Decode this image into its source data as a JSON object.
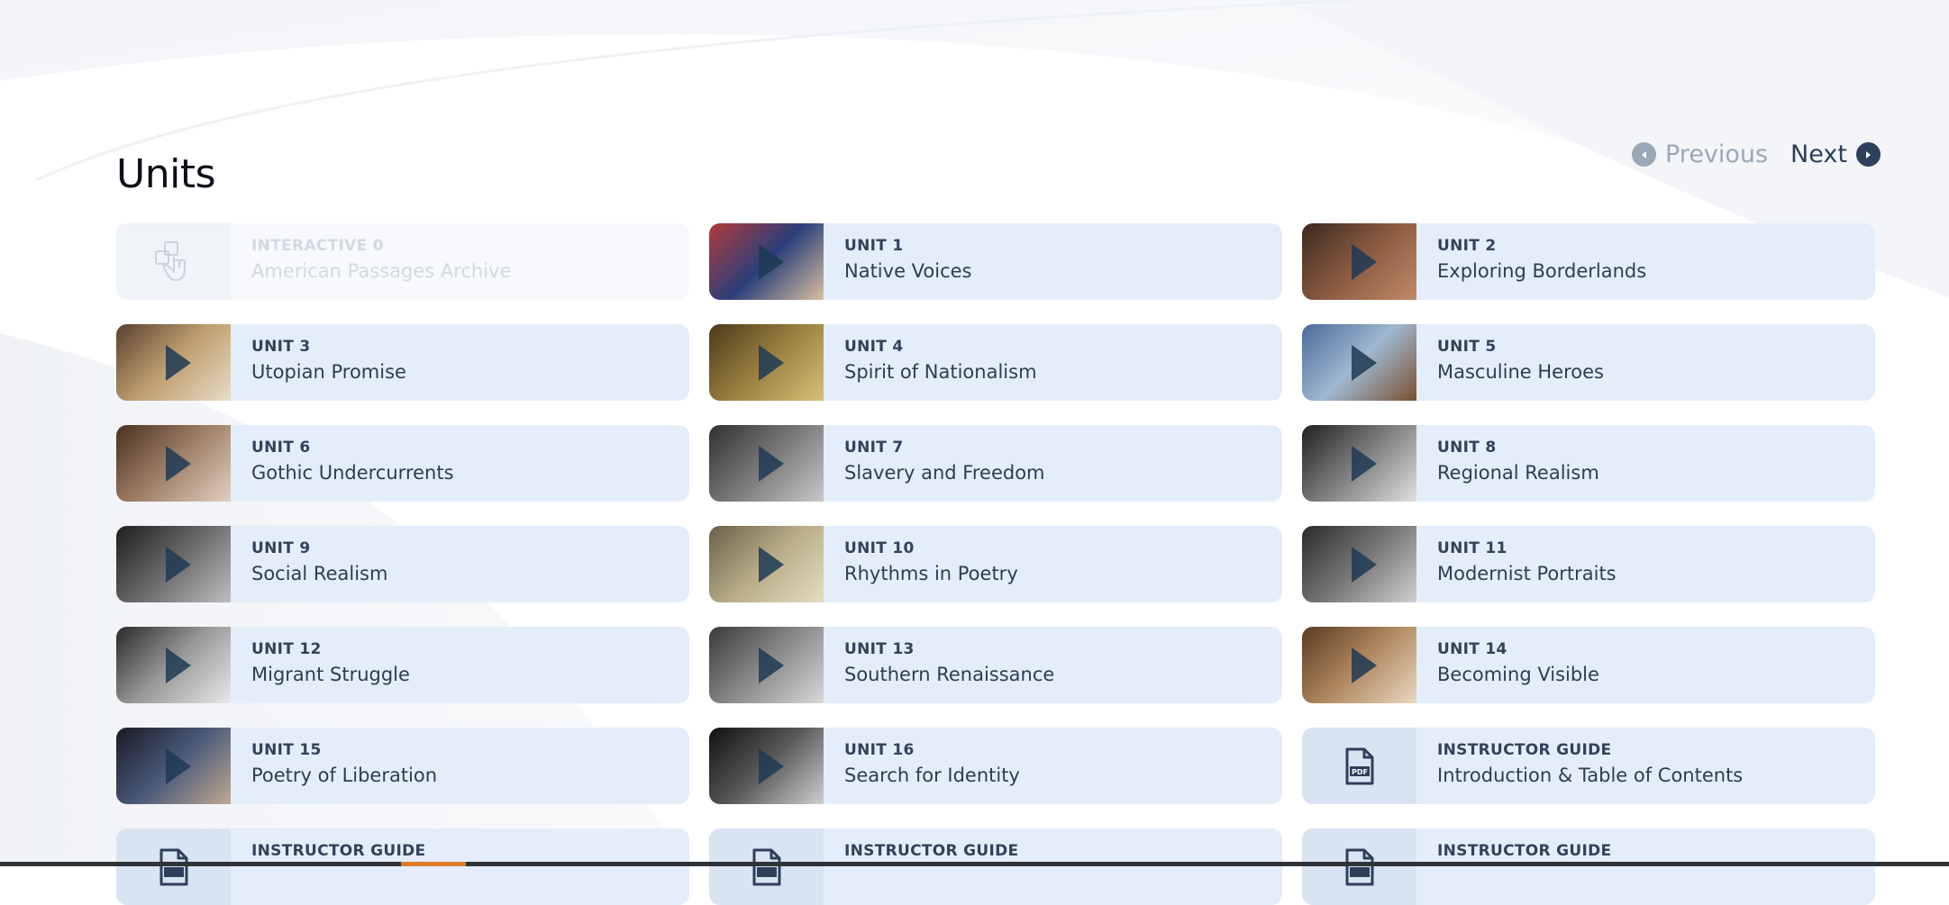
{
  "page": {
    "title": "Units"
  },
  "pager": {
    "previous_label": "Previous",
    "next_label": "Next"
  },
  "cards": [
    {
      "eyebrow": "INTERACTIVE 0",
      "name": "American Passages Archive",
      "kind": "interactive",
      "disabled": true,
      "icon": "hand-pointer-icon"
    },
    {
      "eyebrow": "UNIT 1",
      "name": "Native Voices",
      "kind": "video",
      "thumb_colors": [
        "#b23a3a",
        "#2a3f7a",
        "#d9c0a0"
      ]
    },
    {
      "eyebrow": "UNIT 2",
      "name": "Exploring Borderlands",
      "kind": "video",
      "thumb_colors": [
        "#3a2a20",
        "#8a5a40",
        "#c08a68"
      ]
    },
    {
      "eyebrow": "UNIT 3",
      "name": "Utopian Promise",
      "kind": "video",
      "thumb_colors": [
        "#5a4030",
        "#c0a070",
        "#e8dcc8"
      ]
    },
    {
      "eyebrow": "UNIT 4",
      "name": "Spirit of Nationalism",
      "kind": "video",
      "thumb_colors": [
        "#4a3a1a",
        "#9a8040",
        "#d8c078"
      ]
    },
    {
      "eyebrow": "UNIT 5",
      "name": "Masculine Heroes",
      "kind": "video",
      "thumb_colors": [
        "#4a6a9a",
        "#a0b8d0",
        "#7a5030"
      ]
    },
    {
      "eyebrow": "UNIT 6",
      "name": "Gothic Undercurrents",
      "kind": "video",
      "thumb_colors": [
        "#4a3020",
        "#a08068",
        "#e0d0c0"
      ]
    },
    {
      "eyebrow": "UNIT 7",
      "name": "Slavery and Freedom",
      "kind": "video",
      "thumb_colors": [
        "#303030",
        "#7a7a7a",
        "#c8c8c8"
      ]
    },
    {
      "eyebrow": "UNIT 8",
      "name": "Regional Realism",
      "kind": "video",
      "thumb_colors": [
        "#202020",
        "#808080",
        "#e0e0e0"
      ]
    },
    {
      "eyebrow": "UNIT 9",
      "name": "Social Realism",
      "kind": "video",
      "thumb_colors": [
        "#1e1e1e",
        "#6a6a6a",
        "#bdbdbd"
      ]
    },
    {
      "eyebrow": "UNIT 10",
      "name": "Rhythms in Poetry",
      "kind": "video",
      "thumb_colors": [
        "#6a6048",
        "#b8ac88",
        "#e6dcc0"
      ]
    },
    {
      "eyebrow": "UNIT 11",
      "name": "Modernist Portraits",
      "kind": "video",
      "thumb_colors": [
        "#2a2a2a",
        "#777777",
        "#cfcfcf"
      ]
    },
    {
      "eyebrow": "UNIT 12",
      "name": "Migrant Struggle",
      "kind": "video",
      "thumb_colors": [
        "#2a2a2a",
        "#9a9a9a",
        "#e8e8e8"
      ]
    },
    {
      "eyebrow": "UNIT 13",
      "name": "Southern Renaissance",
      "kind": "video",
      "thumb_colors": [
        "#3a3a3a",
        "#8a8a8a",
        "#d8d8d8"
      ]
    },
    {
      "eyebrow": "UNIT 14",
      "name": "Becoming Visible",
      "kind": "video",
      "thumb_colors": [
        "#5a3a20",
        "#b08860",
        "#e8d8c0"
      ]
    },
    {
      "eyebrow": "UNIT 15",
      "name": "Poetry of Liberation",
      "kind": "video",
      "thumb_colors": [
        "#1a1a24",
        "#4a5a7a",
        "#c0a890"
      ]
    },
    {
      "eyebrow": "UNIT 16",
      "name": "Search for Identity",
      "kind": "video",
      "thumb_colors": [
        "#101010",
        "#5a5a5a",
        "#d0d0d0"
      ]
    },
    {
      "eyebrow": "INSTRUCTOR GUIDE",
      "name": "Introduction & Table of Contents",
      "kind": "pdf",
      "icon": "pdf-file-icon",
      "icon_text": "PDF"
    },
    {
      "eyebrow": "INSTRUCTOR GUIDE",
      "name": "",
      "kind": "pdf",
      "icon": "file-icon"
    },
    {
      "eyebrow": "INSTRUCTOR GUIDE",
      "name": "",
      "kind": "pdf",
      "icon": "file-icon"
    },
    {
      "eyebrow": "INSTRUCTOR GUIDE",
      "name": "",
      "kind": "pdf",
      "icon": "file-icon"
    }
  ],
  "colors": {
    "card_bg": "#e4eefb",
    "card_disabled_bg": "#f7f9fc",
    "heading": "#0b0f17",
    "text": "#2f3d52",
    "pager_active": "#2d3f5a",
    "pager_inactive": "#9ba8b7",
    "play_icon": "#1e3a55"
  }
}
